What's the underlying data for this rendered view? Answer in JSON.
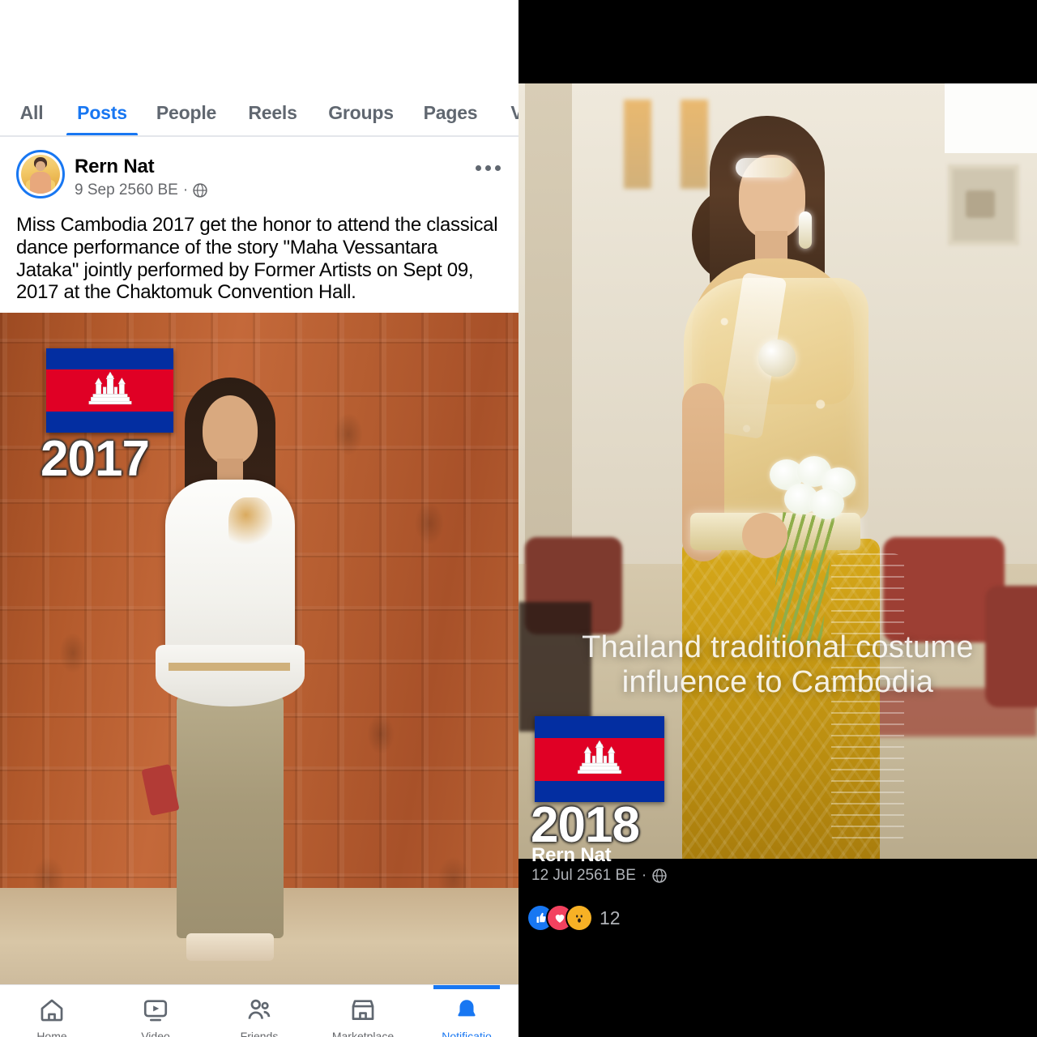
{
  "left": {
    "tabs": [
      {
        "label": "All",
        "active": false
      },
      {
        "label": "Posts",
        "active": true
      },
      {
        "label": "People",
        "active": false
      },
      {
        "label": "Reels",
        "active": false
      },
      {
        "label": "Groups",
        "active": false
      },
      {
        "label": "Pages",
        "active": false
      },
      {
        "label": "V",
        "active": false
      }
    ],
    "post": {
      "author": "Rern Nat",
      "date": "9 Sep 2560 BE",
      "separator": "·",
      "privacy_icon": "globe-icon",
      "menu_icon": "ellipsis-icon",
      "body": "Miss Cambodia 2017 get the honor to attend the classical dance performance of the story \"Maha Vessantara Jataka\" jointly performed by Former Artists on Sept 09, 2017 at the Chaktomuk Convention Hall."
    },
    "photo_overlay": {
      "flag": "cambodia-flag",
      "year": "2017"
    },
    "bottom_nav": [
      {
        "label": "Home",
        "icon": "home-icon",
        "active": false
      },
      {
        "label": "Video",
        "icon": "video-icon",
        "active": false
      },
      {
        "label": "Friends",
        "icon": "friends-icon",
        "active": false
      },
      {
        "label": "Marketplace",
        "icon": "marketplace-icon",
        "active": false
      },
      {
        "label": "Notificatio",
        "icon": "bell-icon",
        "active": true
      }
    ]
  },
  "right": {
    "overlay_caption_line1": "Thailand traditional costume",
    "overlay_caption_line2": "influence to Cambodia",
    "flag": "cambodia-flag",
    "year": "2018",
    "author": "Rern Nat",
    "date": "12 Jul 2561 BE",
    "separator": "·",
    "privacy_icon": "globe-icon",
    "reactions": {
      "icons": [
        "like-icon",
        "love-icon",
        "wow-icon"
      ],
      "count": "12"
    }
  },
  "colors": {
    "facebook_blue": "#1877F2",
    "like_blue": "#1877F2",
    "love_red": "#F3425F",
    "wow_yellow": "#F7B125",
    "flag_blue": "#032EA1",
    "flag_red": "#E00025",
    "text_primary": "#050505",
    "text_secondary": "#65676b",
    "dark_bg": "#000000"
  }
}
